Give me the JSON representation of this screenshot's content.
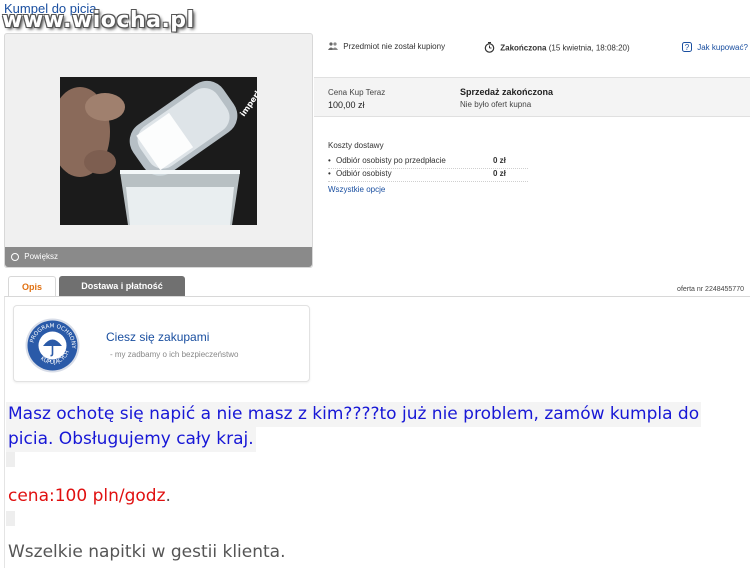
{
  "header": {
    "title": "Kumpel do picia",
    "watermark": "www.wiocha.pl"
  },
  "photo": {
    "caption": "imperkmcluchow",
    "zoom_label": "Powiększ"
  },
  "status": {
    "not_bought": "Przedmiot nie został kupiony",
    "ended_label": "Zakończona",
    "ended_date": "(15 kwietnia, 18:08:20)",
    "how_to_buy": "Jak kupować?"
  },
  "price": {
    "label": "Cena Kup Teraz",
    "value": "100,00 zł",
    "sale_status": "Sprzedaż zakończona",
    "offers": "Nie było ofert kupna"
  },
  "shipping": {
    "title": "Koszty dostawy",
    "items": [
      {
        "bullet": "•",
        "name": "Odbiór osobisty po przedpłacie",
        "cost": "0 zł"
      },
      {
        "bullet": "•",
        "name": "Odbiór osobisty",
        "cost": "0 zł"
      }
    ],
    "all_options": "Wszystkie opcje"
  },
  "tabs": {
    "description": "Opis",
    "delivery": "Dostawa i płatność"
  },
  "offer_number": "oferta nr 2248455770",
  "protection": {
    "badge_top": "PROGRAM OCHRONY",
    "badge_bottom": "KUPUJĄCYCH",
    "title": "Ciesz się zakupami",
    "subtitle": "-  my zadbamy o ich bezpieczeństwo"
  },
  "description": {
    "line1": "Masz ochotę się napić a nie masz z kim????to już nie problem, zamów kumpla do",
    "line2": "picia. Obsługujemy cały kraj.",
    "price_prefix": "cena:100 pln/godz",
    "price_suffix": ".",
    "drinks": "Wszelkie napitki w gestii klienta."
  },
  "colors": {
    "link": "#1a4fa0",
    "accent": "#e07010",
    "desc_blue": "#1717d6",
    "desc_red": "#e01010"
  }
}
